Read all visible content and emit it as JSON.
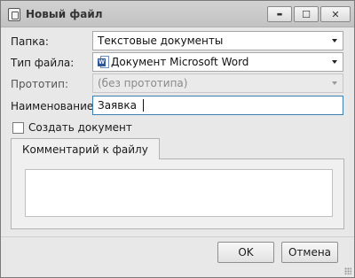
{
  "window": {
    "title": "Новый файл"
  },
  "window_controls": {
    "minimize": "▬",
    "maximize": "☐",
    "close": "✕"
  },
  "form": {
    "folder": {
      "label": "Папка:",
      "value": "Текстовые документы"
    },
    "file_type": {
      "label": "Тип файла:",
      "value": "Документ Microsoft Word",
      "icon": "word-document-icon"
    },
    "prototype": {
      "label": "Прототип:",
      "value": "(без прототипа)",
      "disabled": true
    },
    "name": {
      "label": "Наименование:",
      "value": "Заявка"
    },
    "create_document": {
      "label": "Создать документ",
      "checked": false
    }
  },
  "tabs": [
    {
      "label": "Комментарий к файлу",
      "active": true
    }
  ],
  "comment": {
    "value": ""
  },
  "buttons": {
    "ok": "OK",
    "cancel": "Отмена"
  },
  "colors": {
    "focus_border": "#3c7fb1",
    "title_bar": "#c6c6c6",
    "word_icon": "#2b5797"
  }
}
